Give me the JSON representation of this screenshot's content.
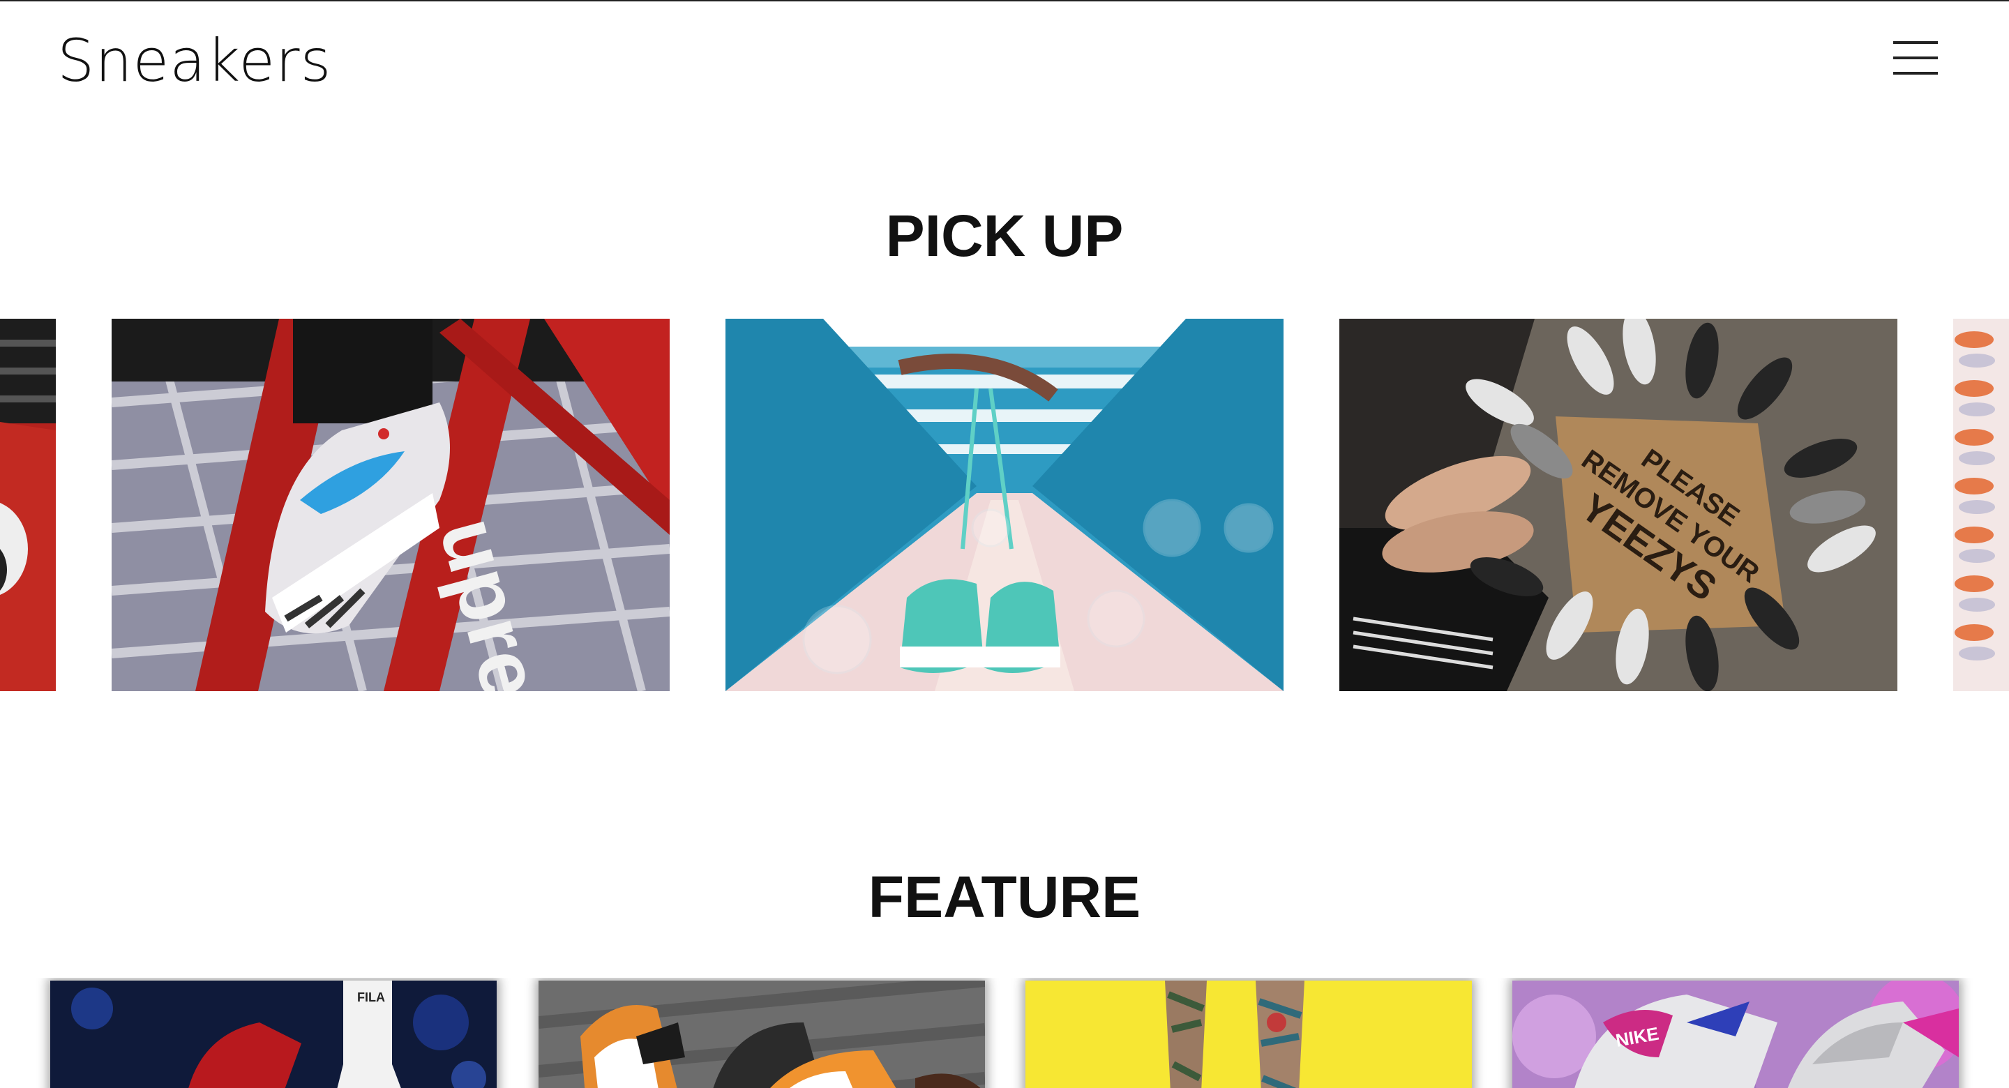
{
  "header": {
    "logo": "Sneakers",
    "menu_icon": "hamburger-menu-icon"
  },
  "pickup": {
    "title": "PICK UP",
    "slides": [
      {
        "id": "slide-partial-left"
      },
      {
        "id": "slide-red-stripes"
      },
      {
        "id": "slide-blue-bridge"
      },
      {
        "id": "slide-doormat",
        "mat_text": [
          "PLEASE",
          "REMOVE YOUR",
          "YEEZYS"
        ]
      },
      {
        "id": "slide-partial-right"
      }
    ]
  },
  "feature": {
    "title": "FEATURE",
    "cards": [
      {
        "id": "card-1",
        "accent": "#c0392b"
      },
      {
        "id": "card-2",
        "accent": "#e67e22"
      },
      {
        "id": "card-3",
        "accent": "#f7e733"
      },
      {
        "id": "card-4",
        "accent": "#c36ed6"
      }
    ]
  },
  "colors": {
    "text": "#111111",
    "background": "#ffffff"
  }
}
